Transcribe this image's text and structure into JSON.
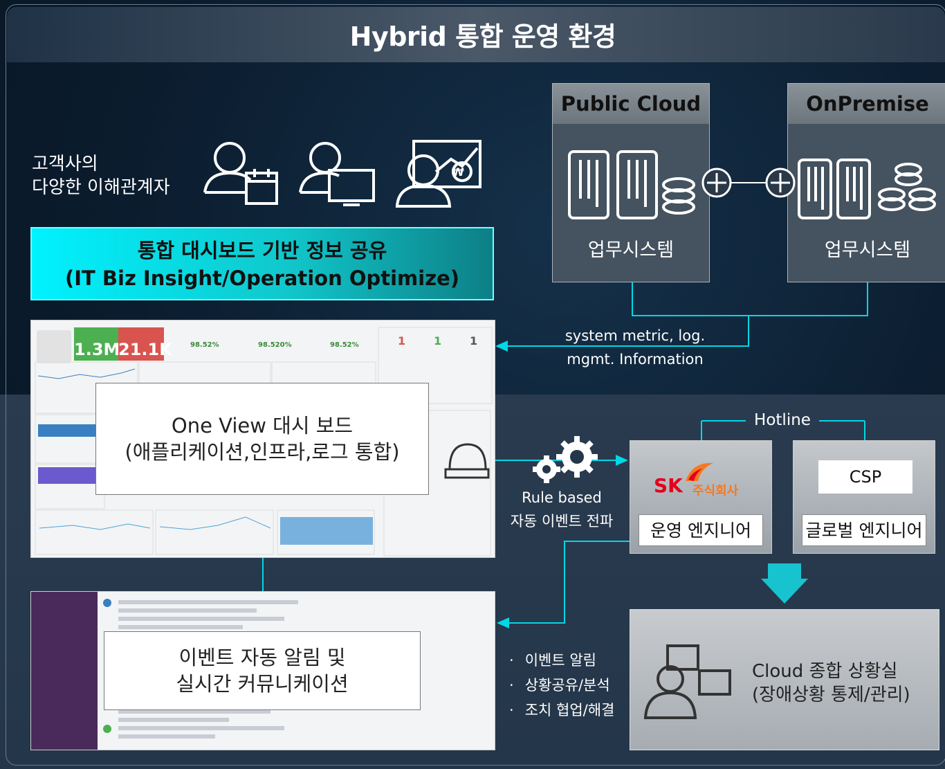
{
  "title": "Hybrid 통합 운영 환경",
  "stakeholders": {
    "line1": "고객사의",
    "line2": "다양한 이해관계자"
  },
  "banner": {
    "line1": "통합 대시보드 기반 정보 공유",
    "line2": "(IT Biz Insight/Operation Optimize)"
  },
  "public_cloud": {
    "header": "Public Cloud",
    "label": "업무시스템"
  },
  "on_premise": {
    "header": "OnPremise",
    "label": "업무시스템"
  },
  "metrics_flow": {
    "line1": "system metric, log.",
    "line2": "mgmt. Information"
  },
  "dashboard": {
    "kpi1": "1.3M",
    "kpi2": "21.1K",
    "pct1": "98.52%",
    "pct2": "98.520%",
    "pct3": "98.52%",
    "count1": "1",
    "count2": "1",
    "count3": "1",
    "overlay_line1": "One View 대시 보드",
    "overlay_line2": "(애플리케이션,인프라,로그 통합)"
  },
  "rule_flow": {
    "line1": "Rule based",
    "line2": "자동 이벤트 전파"
  },
  "hotline": "Hotline",
  "sk_engineer": {
    "logo_sk": "SK",
    "logo_company": "주식회사",
    "label": "운영 엔지니어"
  },
  "csp_engineer": {
    "badge": "CSP",
    "label": "글로벌 엔지니어"
  },
  "chat": {
    "overlay_line1": "이벤트 자동 알림 및",
    "overlay_line2": "실시간 커뮤니케이션"
  },
  "bullets": [
    "이벤트 알림",
    "상황공유/분석",
    "조치 협업/해결"
  ],
  "control_room": {
    "line1": "Cloud 종합 상황실",
    "line2": "(장애상황 통제/관리)"
  },
  "colors": {
    "accent": "#00e5f0",
    "arrow": "#00d8e6",
    "sk_red": "#e3001b",
    "sk_orange": "#f47920"
  }
}
